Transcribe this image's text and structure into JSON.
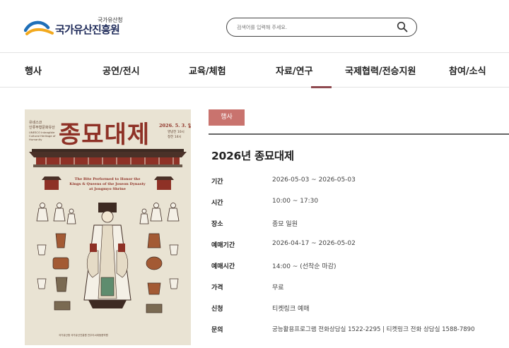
{
  "header": {
    "logo_small": "국가유산청",
    "logo_main": "국가유산진흥원",
    "search_placeholder": "검색어를 입력해 주세요."
  },
  "nav": {
    "items": [
      {
        "label": "행사"
      },
      {
        "label": "공연/전시"
      },
      {
        "label": "교육/체험"
      },
      {
        "label": "자료/연구"
      },
      {
        "label": "국제협력/전승지원"
      },
      {
        "label": "참여/소식"
      }
    ]
  },
  "poster": {
    "title": "종묘대제",
    "top_left_line1": "유네스코",
    "top_left_line2": "인류무형문화유산",
    "top_left_line3": "UNESCO Intangible Cultural Heritage of Humanity",
    "date": "2026. 5. 3. 일",
    "time1": "영녕전 10시",
    "time2": "정전 14시",
    "english": "The Rite Performed to Honor the Kings & Queens of the Joseon Dynasty at Jongmyo Shrine",
    "footer": "국가유산청   국가유산진흥원   전주이씨대동종약원"
  },
  "event": {
    "category": "행사",
    "title": "2026년 종묘대제",
    "rows": [
      {
        "label": "기간",
        "value": "2026-05-03 ~ 2026-05-03"
      },
      {
        "label": "시간",
        "value": "10:00 ~ 17:30"
      },
      {
        "label": "장소",
        "value": "종묘 일원"
      },
      {
        "label": "예매기간",
        "value": "2026-04-17 ~ 2026-05-02"
      },
      {
        "label": "예매시간",
        "value": "14:00 ~ (선착순 마감)"
      },
      {
        "label": "가격",
        "value": "무료"
      },
      {
        "label": "신청",
        "value": "티켓링크 예매"
      },
      {
        "label": "문의",
        "value": "궁능활용프로그램 전화상담실 1522-2295 | 티켓링크 전화 상담실 1588-7890"
      }
    ]
  },
  "colors": {
    "brand_navy": "#1f2b5a",
    "accent": "#8f4a50",
    "tag_bg": "#c9736e",
    "poster_red": "#8e3126",
    "poster_bg": "#e9e3d3"
  },
  "icons": {
    "search": "search-icon",
    "logo": "logo-wave-icon"
  }
}
